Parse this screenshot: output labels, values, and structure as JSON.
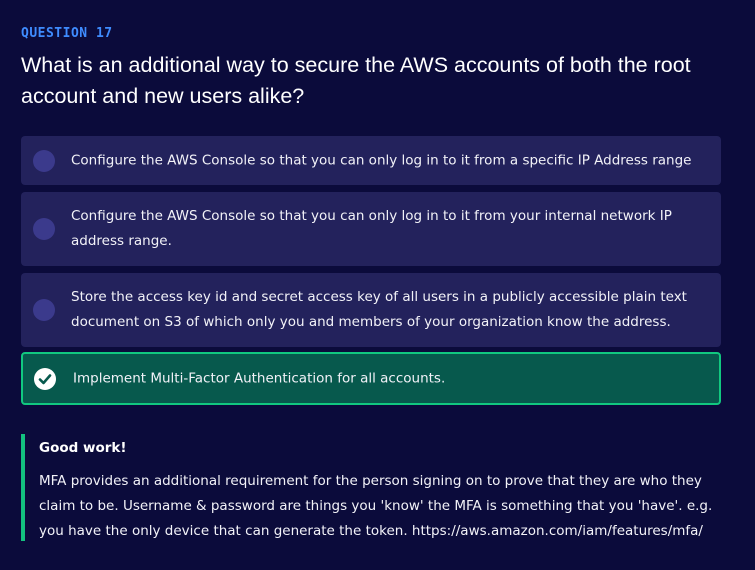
{
  "question": {
    "label": "QUESTION 17",
    "title": "What is an additional way to secure the AWS accounts of both the root account and new users alike?"
  },
  "options": [
    {
      "text": "Configure the AWS Console so that you can only log in to it from a specific IP Address range",
      "selected": false
    },
    {
      "text": "Configure the AWS Console so that you can only log in to it from your internal network IP address range.",
      "selected": false
    },
    {
      "text": "Store the access key id and secret access key of all users in a publicly accessible plain text document on S3 of which only you and members of your organization know the address.",
      "selected": false
    },
    {
      "text": "Implement Multi-Factor Authentication for all accounts.",
      "selected": true
    }
  ],
  "feedback": {
    "title": "Good work!",
    "body": "MFA provides an additional requirement for the person signing on to prove that they are who they claim to be. Username & password are things you 'know' the MFA is something that you 'have'. e.g. you have the only device that can generate the token. https://aws.amazon.com/iam/features/mfa/"
  },
  "colors": {
    "background": "#0b0b3b",
    "label": "#3f8cff",
    "option_bg": "#23225c",
    "correct_bg": "#07594d",
    "correct_border": "#11c880",
    "feedback_bar": "#13c17f"
  }
}
